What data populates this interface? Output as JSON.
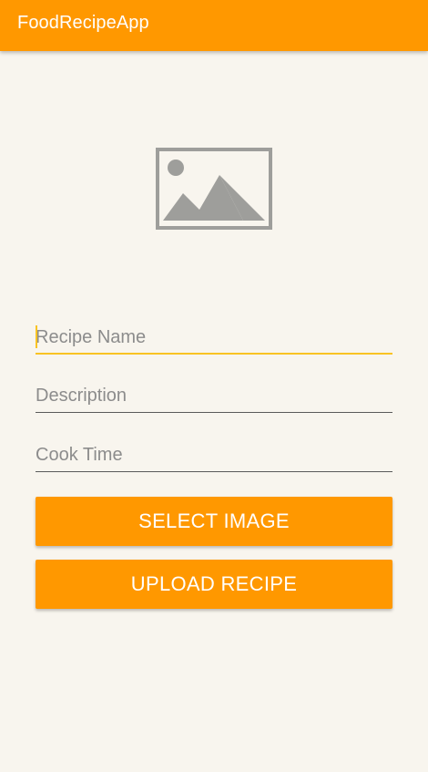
{
  "app_bar": {
    "title": "FoodRecipeApp",
    "color": "#ff9800"
  },
  "image_placeholder": {
    "icon": "image-icon"
  },
  "form": {
    "recipe_name": {
      "placeholder": "Recipe Name",
      "value": ""
    },
    "description": {
      "placeholder": "Description",
      "value": ""
    },
    "cook_time": {
      "placeholder": "Cook Time",
      "value": ""
    }
  },
  "buttons": {
    "select_image": "SELECT IMAGE",
    "upload_recipe": "UPLOAD RECIPE"
  },
  "colors": {
    "accent": "#ff9800",
    "focus": "#f9c323",
    "background": "#f8f5ee"
  }
}
